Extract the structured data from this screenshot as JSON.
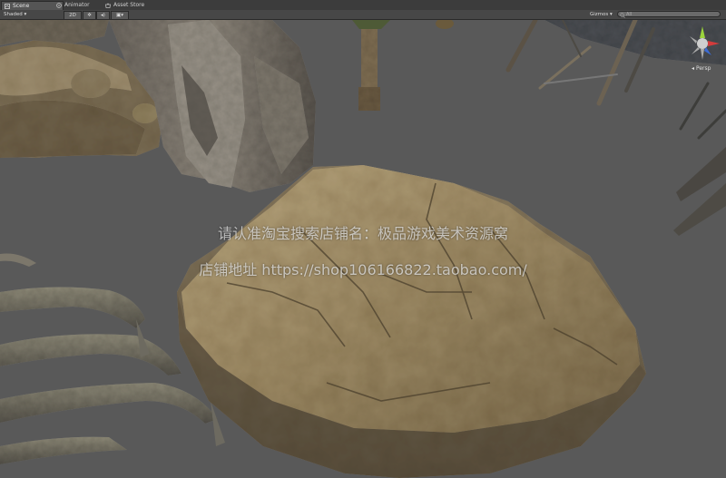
{
  "tabs": [
    {
      "label": "Scene",
      "icon": "scene-icon",
      "active": true
    },
    {
      "label": "Animator",
      "icon": "animator-icon",
      "active": false
    },
    {
      "label": "Asset Store",
      "icon": "asset-store-icon",
      "active": false
    }
  ],
  "toolbar": {
    "shading_mode": "Shaded",
    "mode_2d": "2D",
    "gizmos_label": "Gizmos",
    "search_placeholder": "All"
  },
  "scene": {
    "projection_label": "Persp",
    "watermark_line1": "请认准淘宝搜索店铺名：极品游戏美术资源窝",
    "watermark_line2": "店铺地址 https://shop106166822.taobao.com/"
  },
  "colors": {
    "editor_bg": "#3c3c3c",
    "viewport_bg": "#595959",
    "rock_base": "#8a7a5c",
    "gizmo_x": "#d43c3c",
    "gizmo_y": "#9bd43c",
    "gizmo_z": "#3c6bd4"
  }
}
